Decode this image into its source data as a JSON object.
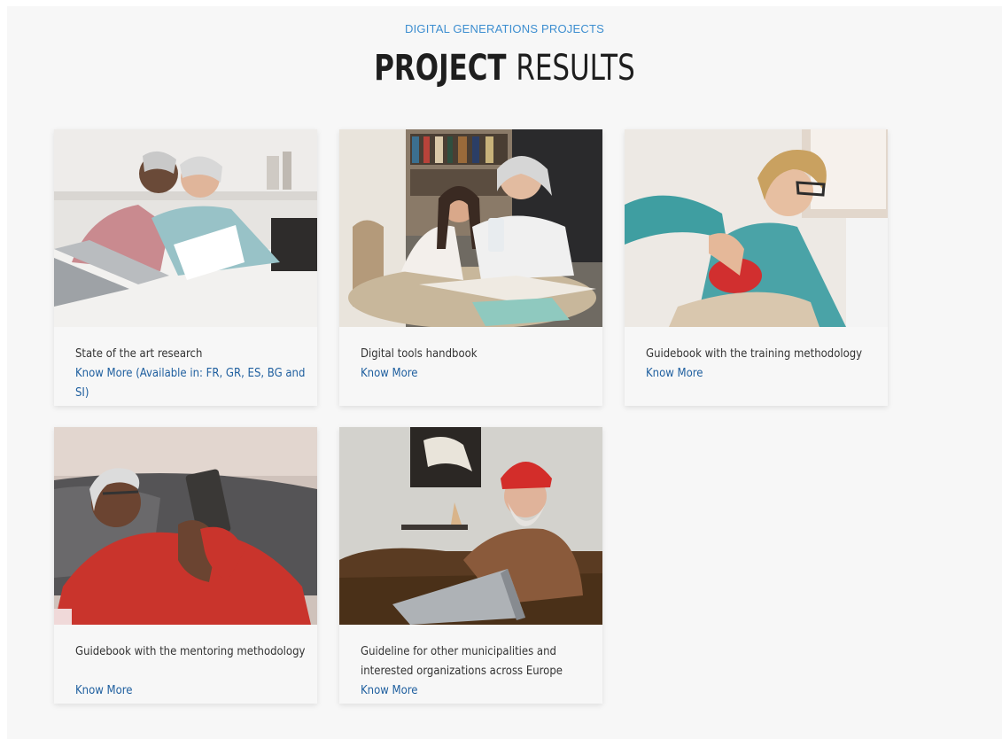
{
  "header": {
    "eyebrow": "DIGITAL GENERATIONS PROJECTS",
    "title_strong": "PROJECT",
    "title_light": "RESULTS"
  },
  "cards": [
    {
      "title": "State of the art research",
      "link": "Know More (Available in: FR, GR, ES, BG and SI)"
    },
    {
      "title": "Digital tools handbook",
      "link": "Know More"
    },
    {
      "title": "Guidebook with the training methodology",
      "link": "Know More"
    },
    {
      "title": "Guidebook with the mentoring methodology",
      "link": "Know More"
    },
    {
      "title": "Guideline for other municipalities and interested organizations across Europe",
      "link": "Know More"
    }
  ],
  "colors": {
    "background": "#f7f7f7",
    "eyebrow": "#3d8ed0",
    "link": "#1f5f9f",
    "heading": "#1e1e1e"
  }
}
